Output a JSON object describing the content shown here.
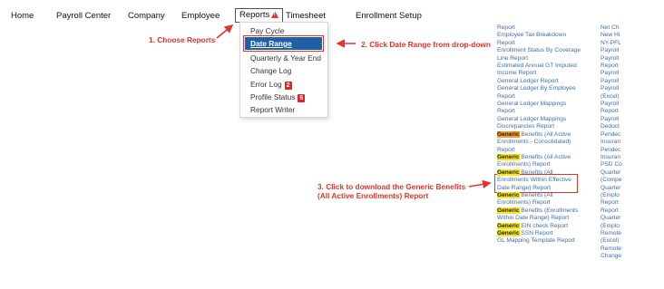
{
  "nav": {
    "home": "Home",
    "payroll_center": "Payroll Center",
    "company": "Company",
    "employee": "Employee",
    "reports": "Reports",
    "timesheet": "Timesheet",
    "enrollment_setup": "Enrollment Setup"
  },
  "dropdown": {
    "items": [
      "Pay Cycle",
      "Date Range",
      "Quarterly & Year End",
      "Change Log",
      "Error Log",
      "Profile Status",
      "Report Writer"
    ],
    "error_log_badge": "2",
    "profile_status_badge": "6"
  },
  "annotations": {
    "step1": "1. Choose Reports",
    "step2": "2. Click Date Range from drop-down",
    "step3_line1": "3. Click to download the Generic Benefits",
    "step3_line2": "(All Active Enrollments) Report"
  },
  "highlight_colors": {
    "yellow": "#f3e526",
    "orange": "#f0a030",
    "annotation_red": "#e0352b",
    "active_blue": "#1f5fa5"
  },
  "reports_col1": [
    {
      "pre": "",
      "hl": "",
      "text": "Report"
    },
    {
      "pre": "",
      "hl": "",
      "text": "Employee Tax Breakdown"
    },
    {
      "pre": "",
      "hl": "",
      "text": "Report"
    },
    {
      "pre": "",
      "hl": "",
      "text": "Enrollment Status By Coverage"
    },
    {
      "pre": "",
      "hl": "",
      "text": "Line Report"
    },
    {
      "pre": "",
      "hl": "",
      "text": "Estimated Annual GT Imputed"
    },
    {
      "pre": "",
      "hl": "",
      "text": "Income Report"
    },
    {
      "pre": "",
      "hl": "",
      "text": "General Ledger Report"
    },
    {
      "pre": "",
      "hl": "",
      "text": "General Ledger By Employee"
    },
    {
      "pre": "",
      "hl": "",
      "text": "Report"
    },
    {
      "pre": "",
      "hl": "",
      "text": "General Ledger Mappings"
    },
    {
      "pre": "",
      "hl": "",
      "text": "Report"
    },
    {
      "pre": "",
      "hl": "",
      "text": "General Ledger Mappings"
    },
    {
      "pre": "",
      "hl": "",
      "text": "Discrepancies Report"
    },
    {
      "pre": "",
      "hl": "Generic",
      "hlc": "orange",
      "text": " Benefits (All Active"
    },
    {
      "pre": "",
      "hl": "",
      "text": "Enrollments - Consolidated)"
    },
    {
      "pre": "",
      "hl": "",
      "text": "Report"
    },
    {
      "pre": "",
      "hl": "Generic",
      "hlc": "yellow",
      "text": " Benefits (All Active"
    },
    {
      "pre": "",
      "hl": "",
      "text": "Enrollments) Report"
    },
    {
      "pre": "",
      "hl": "Generic",
      "hlc": "yellow",
      "text": " Benefits (All"
    },
    {
      "pre": "",
      "hl": "",
      "text": "Enrollments Within Effective"
    },
    {
      "pre": "",
      "hl": "",
      "text": "Date Range) Report"
    },
    {
      "pre": "",
      "hl": "Generic",
      "hlc": "yellow",
      "text": " Benefits (All"
    },
    {
      "pre": "",
      "hl": "",
      "text": "Enrollments) Report"
    },
    {
      "pre": "",
      "hl": "Generic",
      "hlc": "yellow",
      "text": " Benefits (Enrollments"
    },
    {
      "pre": "",
      "hl": "",
      "text": "Within Date Range) Report"
    },
    {
      "pre": "",
      "hl": "Generic",
      "hlc": "yellow",
      "text": " EIN check Report"
    },
    {
      "pre": "",
      "hl": "Generic",
      "hlc": "yellow",
      "text": " SSN Report"
    },
    {
      "pre": "",
      "hl": "",
      "text": "GL Mapping Template Report"
    }
  ],
  "reports_col2": [
    "Net Ch",
    "New Hi",
    "NY-PFL",
    "Payroll",
    "Payroll",
    "Report",
    "Payroll",
    "Payroll",
    "Payroll",
    "(Excel)",
    "Payroll",
    "Report",
    "Payroll",
    "Deduct",
    "Pendec",
    "Insuran",
    "Pendec",
    "Insuran",
    "PSD Co",
    "Quarter",
    "(Compe",
    "Quarter",
    "(Emplo",
    "Report",
    "Report",
    "Quarter",
    "(Emplo",
    "Remote",
    "(Excel)",
    "Remote",
    "Change"
  ]
}
